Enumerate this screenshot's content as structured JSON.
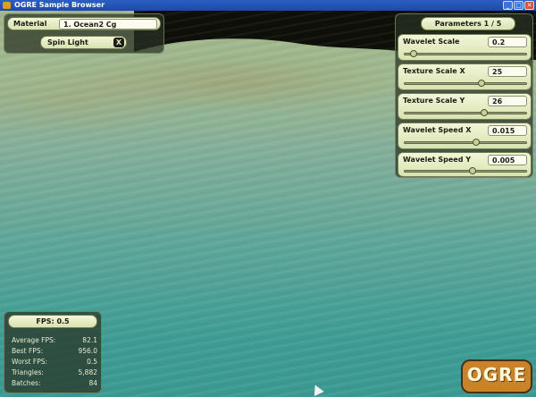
{
  "window": {
    "title": "OGRE Sample Browser",
    "buttons": [
      "_",
      "□",
      "✕"
    ]
  },
  "material_panel": {
    "label": "Material",
    "value": "1. Ocean2 Cg",
    "spin_light_label": "Spin Light",
    "spin_light_toggle": "X"
  },
  "parameters_panel": {
    "title": "Parameters 1 / 5",
    "sliders": [
      {
        "label": "Wavelet Scale",
        "value": "0.2",
        "fraction": 0.05
      },
      {
        "label": "Texture Scale X",
        "value": "25",
        "fraction": 0.64
      },
      {
        "label": "Texture Scale Y",
        "value": "26",
        "fraction": 0.66
      },
      {
        "label": "Wavelet Speed X",
        "value": "0.015",
        "fraction": 0.59
      },
      {
        "label": "Wavelet Speed Y",
        "value": "0.005",
        "fraction": 0.56
      }
    ]
  },
  "stats_panel": {
    "fps_title": "FPS: 0.5",
    "rows": [
      {
        "label": "Average FPS:",
        "value": "82.1"
      },
      {
        "label": "Best FPS:",
        "value": "956.0"
      },
      {
        "label": "Worst FPS:",
        "value": "0.5"
      },
      {
        "label": "Triangles:",
        "value": "5,882"
      },
      {
        "label": "Batches:",
        "value": "84"
      }
    ]
  },
  "logo": {
    "text": "OGRE"
  },
  "colors": {
    "panel": "#283022",
    "pill": "#e8eec8",
    "titlebar": "#2457bd",
    "logo": "#c9842a"
  }
}
